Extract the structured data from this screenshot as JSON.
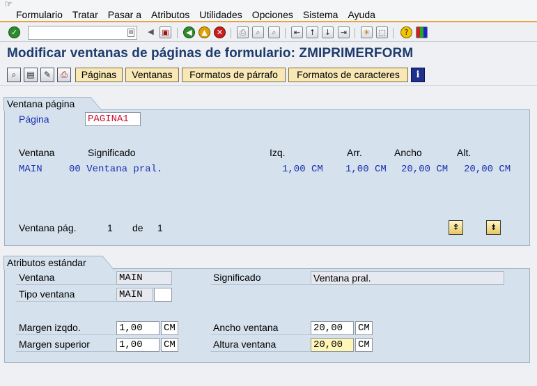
{
  "menu": {
    "items": [
      "Formulario",
      "Tratar",
      "Pasar a",
      "Atributos",
      "Utilidades",
      "Opciones",
      "Sistema",
      "Ayuda"
    ]
  },
  "toolbar": {
    "command_value": "",
    "icons": [
      "enter-icon",
      "back-nav-icon",
      "save-icon",
      "back-icon",
      "exit-icon",
      "cancel-icon",
      "print-icon",
      "find-icon",
      "find-next-icon",
      "first-page-icon",
      "prev-page-icon",
      "next-page-icon",
      "last-page-icon",
      "create-session-icon",
      "shortcut-icon",
      "help-icon",
      "customize-layout-icon"
    ]
  },
  "title": "Modificar ventanas de páginas de formulario: ZMIPRIMERFORM",
  "app_toolbar": {
    "buttons": [
      "Páginas",
      "Ventanas",
      "Formatos de párrafo",
      "Formatos de caracteres"
    ],
    "icons": [
      "display-icon",
      "check-icon",
      "edit-icon",
      "print-icon",
      "info-icon"
    ]
  },
  "ventana_pagina": {
    "group_title": "Ventana página",
    "pagina_label": "Página",
    "pagina_value": "PAGINA1",
    "headers": {
      "ventana": "Ventana",
      "significado": "Significado",
      "izq": "Izq.",
      "arr": "Arr.",
      "ancho": "Ancho",
      "alt": "Alt."
    },
    "rows": [
      {
        "ventana": "MAIN",
        "significado": "00 Ventana pral.",
        "izq": "1,00 CM",
        "arr": "1,00 CM",
        "ancho": "20,00 CM",
        "alt": "20,00 CM"
      }
    ],
    "pager": {
      "label": "Ventana pág.",
      "current": "1",
      "of_label": "de",
      "total": "1"
    }
  },
  "atributos": {
    "group_title": "Atributos estándar",
    "ventana_label": "Ventana",
    "ventana_value": "MAIN",
    "significado_label": "Significado",
    "significado_value": "Ventana pral.",
    "tipo_label": "Tipo ventana",
    "tipo_value": "MAIN",
    "tipo_extra": "",
    "margen_izq_label": "Margen izqdo.",
    "margen_izq_value": "1,00",
    "margen_izq_unit": "CM",
    "margen_sup_label": "Margen superior",
    "margen_sup_value": "1,00",
    "margen_sup_unit": "CM",
    "ancho_label": "Ancho ventana",
    "ancho_value": "20,00",
    "ancho_unit": "CM",
    "altura_label": "Altura ventana",
    "altura_value": "20,00",
    "altura_unit": "CM"
  },
  "colors": {
    "title": "#1d3c6e",
    "accent_line": "#e8a440",
    "group_bg": "#d5e2ee",
    "button_bg": "#f7e8b6",
    "red_value": "#c8102e",
    "highlight_field": "#fff6b8"
  }
}
